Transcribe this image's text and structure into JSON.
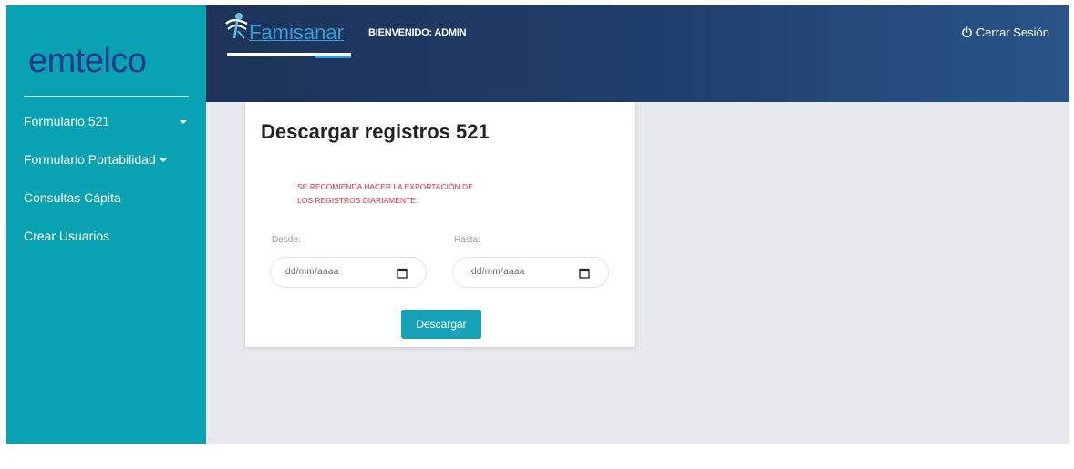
{
  "sidebar": {
    "logo": "emtelco",
    "items": [
      {
        "label": "Formulario 521"
      },
      {
        "label": "Formulario Portabilidad"
      },
      {
        "label": "Consultas Cápita"
      },
      {
        "label": "Crear Usuarios"
      }
    ]
  },
  "header": {
    "brand": "Famisanar",
    "welcome": "BIENVENIDO: ADMIN",
    "logout_label": "Cerrar Sesión"
  },
  "card": {
    "title": "Descargar registros 521",
    "warning_line1": "SE RECOMIENDA HACER LA EXPORTACIÓN DE",
    "warning_line2": "LOS REGISTROS DIARIAMENTE.",
    "from_label": "Desde:",
    "to_label": "Hasta:",
    "from_placeholder": "dd/mm/aaaa",
    "to_placeholder": "dd/mm/aaaa",
    "download_label": "Descargar"
  },
  "colors": {
    "sidebar": "#08a2b2",
    "logo": "#20398f",
    "header_start": "#1d3358",
    "header_end": "#2a5589",
    "warning": "#e8293a",
    "button": "#17a2b8",
    "background": "#e8e9ef"
  }
}
